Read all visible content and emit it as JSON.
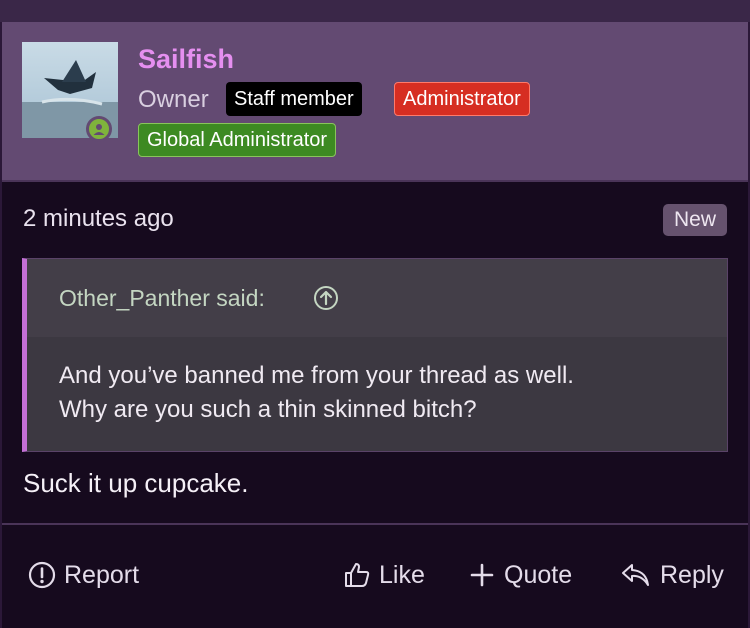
{
  "post": {
    "username": "Sailfish",
    "user_title": "Owner",
    "badges": {
      "staff": "Staff member",
      "admin": "Administrator",
      "global": "Global Administrator"
    },
    "timestamp": "2 minutes ago",
    "new_label": "New",
    "quote": {
      "author": "Other_Panther said:",
      "lines": [
        "And you’ve banned me from your thread as well.",
        "Why are you such a thin skinned bitch?"
      ]
    },
    "message": "Suck it up cupcake.",
    "actions": {
      "report": "Report",
      "like": "Like",
      "quote": "Quote",
      "reply": "Reply"
    }
  },
  "colors": {
    "header_bg": "#634a72",
    "post_bg": "#160a1e",
    "username": "#e58ff0",
    "admin_badge": "#d62e22",
    "global_badge": "#3d8a22",
    "quote_accent": "#c46fd6"
  },
  "icons": [
    "user-online-icon",
    "arrow-up-circle-icon",
    "alert-circle-icon",
    "thumbs-up-icon",
    "plus-icon",
    "reply-icon"
  ]
}
